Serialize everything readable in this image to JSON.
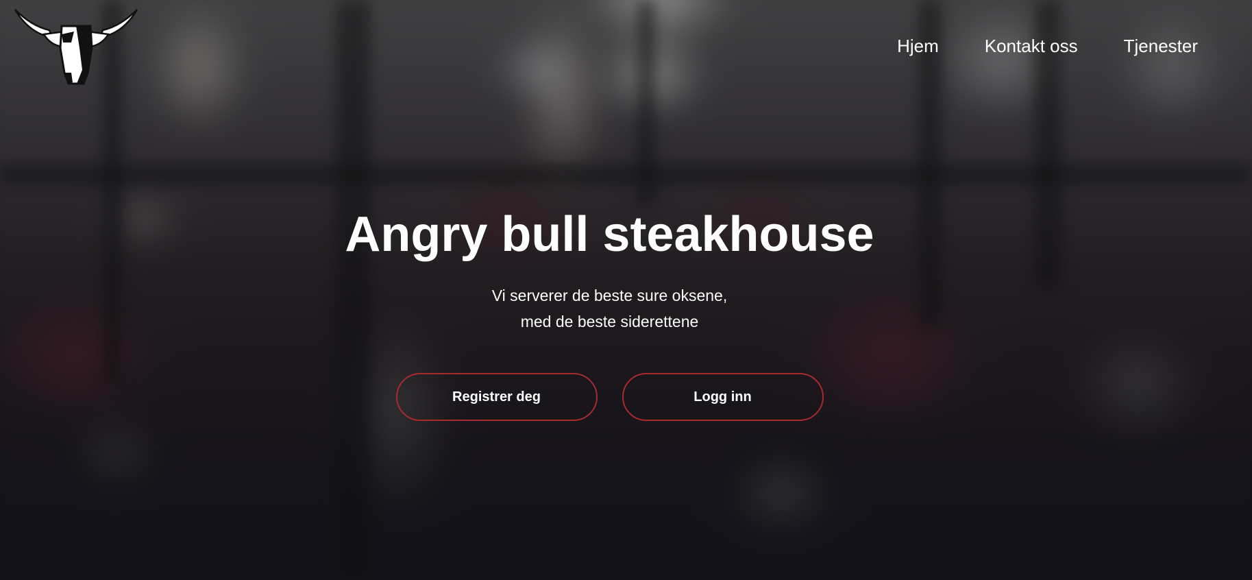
{
  "brand": {
    "logo_icon": "bull-head-icon"
  },
  "nav": {
    "items": [
      {
        "label": "Hjem"
      },
      {
        "label": "Kontakt oss"
      },
      {
        "label": "Tjenester"
      }
    ]
  },
  "hero": {
    "title": "Angry bull steakhouse",
    "subtitle_line1": "Vi serverer de beste sure oksene,",
    "subtitle_line2": "med de beste siderettene",
    "register_button": "Registrer deg",
    "login_button": "Logg inn"
  },
  "colors": {
    "accent": "#a82a2e",
    "text": "#ffffff"
  }
}
